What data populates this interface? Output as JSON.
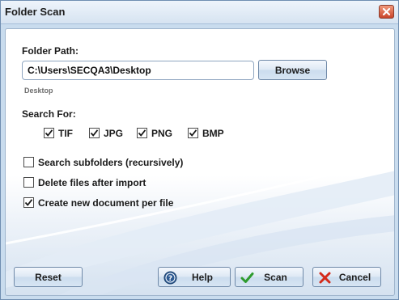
{
  "window": {
    "title": "Folder Scan"
  },
  "folder": {
    "label": "Folder Path:",
    "path_value": "C:\\Users\\SECQA3\\Desktop",
    "hint": "Desktop",
    "browse_label": "Browse"
  },
  "search": {
    "label": "Search For:",
    "types": [
      {
        "label": "TIF",
        "checked": true
      },
      {
        "label": "JPG",
        "checked": true
      },
      {
        "label": "PNG",
        "checked": true
      },
      {
        "label": "BMP",
        "checked": true
      }
    ]
  },
  "options": [
    {
      "label": "Search subfolders (recursively)",
      "checked": false
    },
    {
      "label": "Delete files after import",
      "checked": false
    },
    {
      "label": "Create new document per file",
      "checked": true
    }
  ],
  "buttons": {
    "reset": "Reset",
    "help": "Help",
    "scan": "Scan",
    "cancel": "Cancel"
  },
  "icons": {
    "close": "close-icon",
    "help": "help-icon",
    "scan": "checkmark-icon",
    "cancel": "cross-icon"
  },
  "colors": {
    "window_frame": "#c9dcee",
    "close_button": "#c9452a",
    "scan_check": "#2e9b2e",
    "cancel_cross": "#d42a1a",
    "help_icon": "#2c5a93"
  }
}
